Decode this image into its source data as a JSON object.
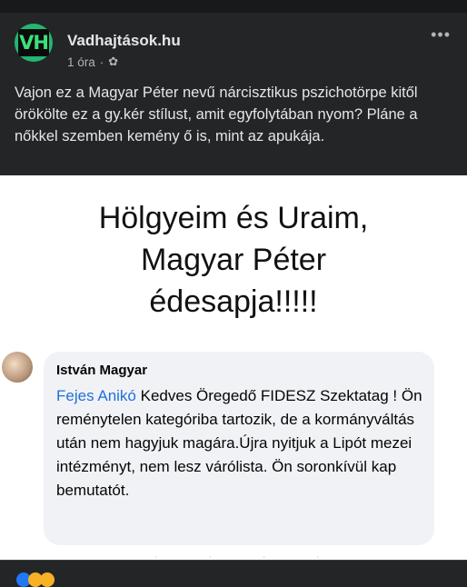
{
  "post": {
    "page_name": "Vadhajtások.hu",
    "avatar_text": "VH",
    "time": "1 óra",
    "separator": "·",
    "more_label": "•••",
    "text": "Vajon ez a Magyar Péter nevű nárcisztikus pszichotörpe kitől örökölte ez a gy.kér stílust, amit egyfolytában nyom? Pláne a nőkkel szemben kemény ő is, mint az apukája."
  },
  "image": {
    "headline_lines": [
      "Hölgyeim és Uraim,",
      "Magyar Péter",
      "édesapja!!!!!"
    ],
    "comment": {
      "author": "István Magyar",
      "mention": "Fejes Anikó",
      "text": " Kedves Öregedő FIDESZ Szektatag ! Ön reménytelen kategóriba tartozik, de a kormányváltás után nem hagyjuk magára.Újra nyitjuk a Lipót mezei intézményt, nem lesz várólista. Ön soronkívül kap bemutatót."
    }
  },
  "icons": {
    "visibility": "gear-icon",
    "more": "more-dots-icon",
    "reactions": [
      "like-reaction-icon",
      "haha-reaction-icon",
      "haha-reaction-icon"
    ]
  },
  "colors": {
    "background": "#242526",
    "text": "#e4e6eb",
    "meta": "#b0b3b8",
    "mention": "#216fdb",
    "avatar": "#22b573"
  }
}
